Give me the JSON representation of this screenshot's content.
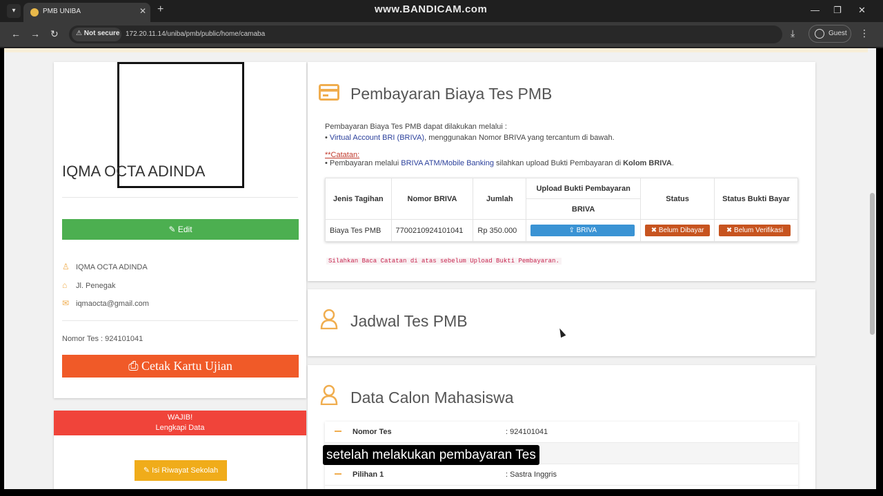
{
  "browser": {
    "tab_title": "PMB UNIBA",
    "watermark": "www.BANDICAM.com",
    "not_secure": "Not secure",
    "url": "172.20.11.14/uniba/pmb/public/home/camaba",
    "guest_label": "Guest"
  },
  "profile": {
    "name": "IQMA OCTA ADINDA",
    "edit_label": "Edit",
    "full_name": "IQMA OCTA ADINDA",
    "address": "Jl. Penegak",
    "email": "iqmaocta@gmail.com",
    "nomor_tes": "Nomor Tes : 924101041",
    "cetak_label": "Cetak Kartu Ujian"
  },
  "wajib": {
    "line1": "WAJIB!",
    "line2": "Lengkapi Data",
    "riwayat_label": "Isi Riwayat Sekolah"
  },
  "payment": {
    "title": "Pembayaran Biaya Tes PMB",
    "intro": "Pembayaran Biaya Tes PMB dapat dilakukan melalui :",
    "bullet1_link": "Virtual Account BRI (BRIVA)",
    "bullet1_rest": ", menggunakan Nomor BRIVA yang tercantum di bawah.",
    "catatan": "**Catatan:",
    "bullet2_pre": "Pembayaran melalui ",
    "bullet2_link": "BRIVA ATM/Mobile Banking",
    "bullet2_mid": " silahkan upload Bukti Pembayaran di ",
    "bullet2_bold": "Kolom BRIVA",
    "bullet2_end": ".",
    "headers": {
      "jenis": "Jenis Tagihan",
      "nomor": "Nomor BRIVA",
      "jumlah": "Jumlah",
      "upload": "Upload Bukti Pembayaran",
      "upload_sub": "BRIVA",
      "status": "Status",
      "status_bukti": "Status Bukti Bayar"
    },
    "row": {
      "jenis": "Biaya Tes PMB",
      "nomor": "7700210924101041",
      "jumlah": "Rp 350.000",
      "upload_btn": "BRIVA",
      "status": "Belum Dibayar",
      "status_bukti": "Belum Verifikasi"
    },
    "note": "Silahkan Baca Catatan di atas sebelum Upload Bukti Pembayaran.",
    "colors": {
      "briva_btn": "#3a93d4",
      "status_btn": "#c7541f"
    }
  },
  "jadwal": {
    "title": "Jadwal Tes PMB"
  },
  "data_calon": {
    "title": "Data Calon Mahasiswa",
    "rows": [
      {
        "key": "Nomor Tes",
        "value": ": 924101041"
      },
      {
        "key": "",
        "value": ""
      },
      {
        "key": "Pilihan 1",
        "value": ": Sastra Inggris"
      }
    ]
  },
  "subtitle": "setelah melakukan pembayaran Tes"
}
